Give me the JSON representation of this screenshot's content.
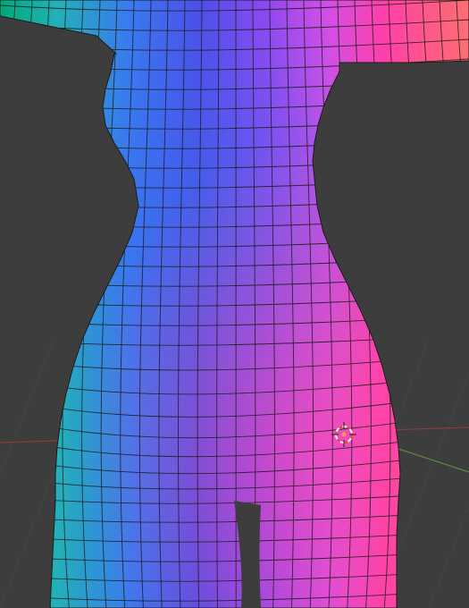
{
  "viewport": {
    "kind": "3d-viewport",
    "shading": "normal-map",
    "background_color": "#3d3d3d",
    "grid_color": "#4a4a4a",
    "x_axis_color": "#8a3b3b",
    "y_axis_color": "#5f8a3b",
    "wire_color": "#1b1b1b",
    "cursor_colors": {
      "ring_a": "#e04a3a",
      "ring_b": "#f0f0f0",
      "center": "#f2a530"
    }
  },
  "model": {
    "label": "mesh-object",
    "display": "wireframe-overlay",
    "palette": [
      "#00a878",
      "#2fb3c6",
      "#3a6df0",
      "#4a4fe8",
      "#7a48f0",
      "#c44fe6",
      "#ff3fa8",
      "#ff5e8c",
      "#ff7a56"
    ]
  },
  "cursor": {
    "label": "3d-cursor"
  }
}
